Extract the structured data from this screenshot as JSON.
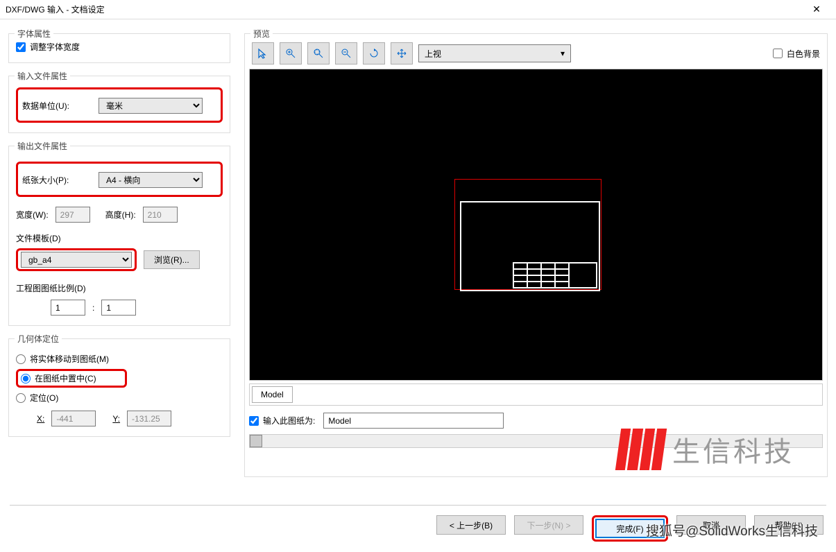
{
  "title": "DXF/DWG 输入 - 文档设定",
  "left": {
    "fontGroup": {
      "title": "字体属性",
      "adjustWidth": "调整字体宽度"
    },
    "inputFileGroup": {
      "title": "输入文件属性",
      "dataUnitLabel": "数据单位(U):",
      "dataUnitValue": "毫米"
    },
    "outputFileGroup": {
      "title": "输出文件属性",
      "paperLabel": "纸张大小(P):",
      "paperValue": "A4 - 横向",
      "widthLabel": "宽度(W):",
      "widthValue": "297",
      "heightLabel": "高度(H):",
      "heightValue": "210",
      "templateLabel": "文件模板(D)",
      "templateValue": "gb_a4",
      "browseBtn": "浏览(R)...",
      "scaleLabel": "工程图图纸比例(D)",
      "scaleNum": "1",
      "scaleColon": ":",
      "scaleDen": "1"
    },
    "geomGroup": {
      "title": "几何体定位",
      "moveOpt": "将实体移动到图纸(M)",
      "centerOpt": "在图纸中置中(C)",
      "posOpt": "定位(O)",
      "xLabel": "X:",
      "xValue": "-441",
      "yLabel": "Y:",
      "yValue": "-131.25"
    }
  },
  "right": {
    "previewTitle": "预览",
    "viewSelect": "上视",
    "whiteBg": "白色背景",
    "tabModel": "Model",
    "inputSheetLabel": "输入此图纸为:",
    "modelValue": "Model"
  },
  "footer": {
    "back": "< 上一步(B)",
    "next": "下一步(N) >",
    "finish": "完成(F)",
    "cancel": "取消",
    "help": "帮助(H)"
  },
  "watermark": {
    "logo": "生信科技",
    "footer": "搜狐号@SolidWorks生信科技"
  }
}
